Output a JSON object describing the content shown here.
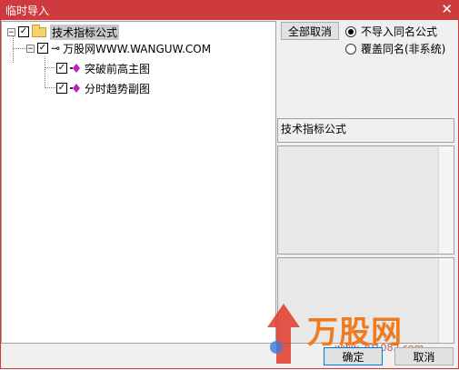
{
  "window": {
    "title": "临时导入",
    "close_glyph": "✕"
  },
  "tree": {
    "root": {
      "label": "技术指标公式",
      "checked": true,
      "expander": "−"
    },
    "source": {
      "label": "万股网WWW.WANGUW.COM",
      "checked": true,
      "expander": "−"
    },
    "items": [
      {
        "label": "突破前高主图",
        "checked": true
      },
      {
        "label": "分时趋势副图",
        "checked": true
      }
    ]
  },
  "controls": {
    "toggle_all_label": "全部取消",
    "options": [
      {
        "label": "不导入同名公式",
        "selected": true
      },
      {
        "label": "覆盖同名(非系统)",
        "selected": false
      }
    ]
  },
  "info": {
    "category_label": "技术指标公式"
  },
  "footer": {
    "ok_label": "确定",
    "cancel_label": "取消"
  },
  "watermark": {
    "brand": "万股网",
    "url": "www.201082.com"
  },
  "colors": {
    "titlebar": "#cd3b3f",
    "formula_icon": "#c020c0",
    "brand_orange": "#f07a20"
  }
}
